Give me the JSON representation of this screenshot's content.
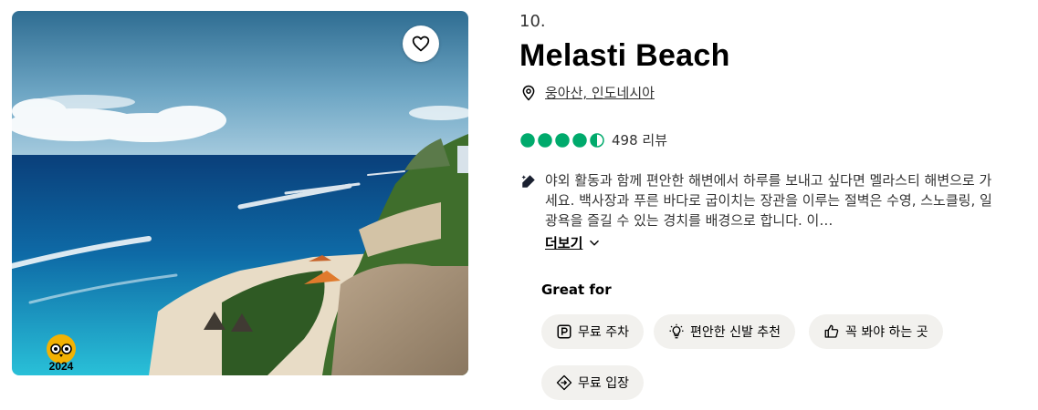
{
  "listing": {
    "rank": "10.",
    "title": "Melasti Beach",
    "location": "웅아산, 인도네시아",
    "rating": 4.5,
    "reviews": "498 리뷰",
    "description": "야외 활동과 함께 편안한 해변에서 하루를 보내고 싶다면 멜라스티 해변으로 가세요. 백사장과 푸른 바다로 굽이치는 장관을 이루는 절벽은 수영, 스노클링, 일광욕을 즐길 수 있는 경치를 배경으로 합니다. 이…",
    "more_label": "더보기",
    "award_year": "2024"
  },
  "great_for": {
    "heading": "Great for",
    "chips": [
      {
        "label": "무료 주차",
        "icon": "parking-icon"
      },
      {
        "label": "편안한 신발 추천",
        "icon": "lightbulb-icon"
      },
      {
        "label": "꼭 봐야 하는 곳",
        "icon": "thumbs-up-icon"
      },
      {
        "label": "무료 입장",
        "icon": "ticket-icon"
      }
    ]
  },
  "colors": {
    "rating_green": "#00aa6c",
    "award_yellow": "#f2b203",
    "chip_bg": "#f2f1ee"
  }
}
